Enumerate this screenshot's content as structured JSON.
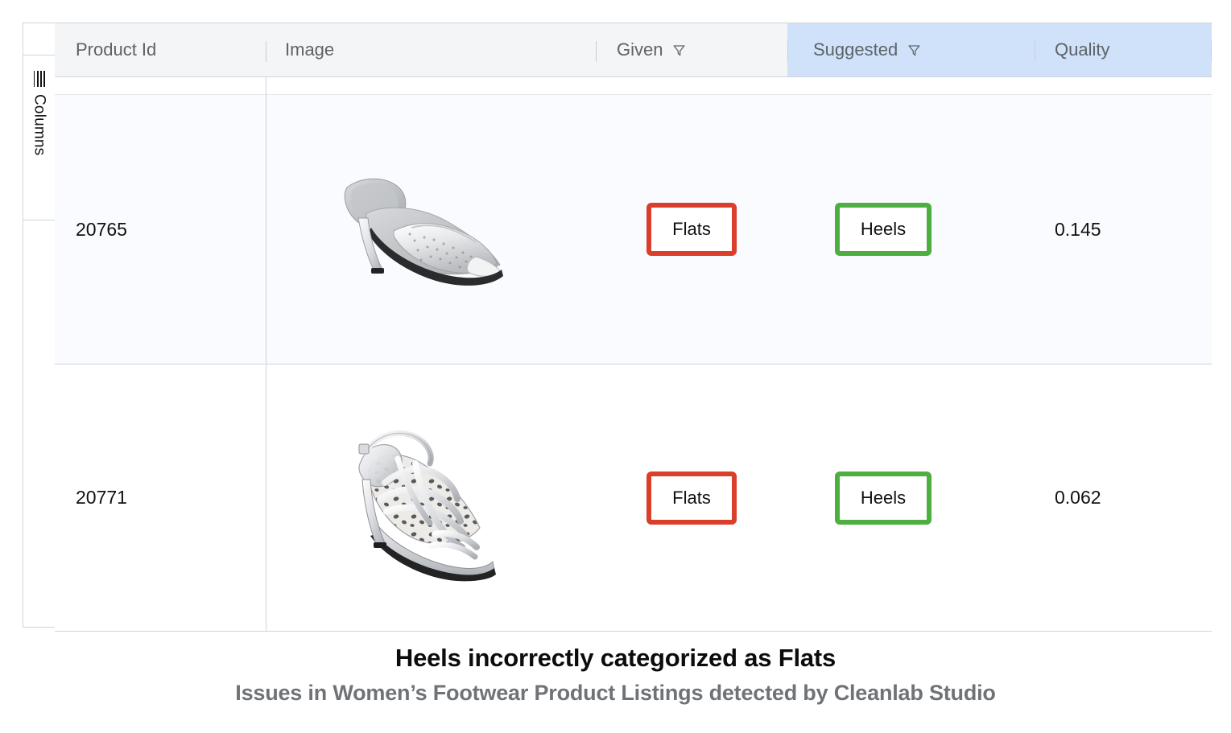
{
  "rail": {
    "label": "Columns",
    "icon": "columns-icon"
  },
  "table": {
    "headers": [
      {
        "key": "product_id",
        "label": "Product Id",
        "filter": false,
        "highlighted": false
      },
      {
        "key": "image",
        "label": "Image",
        "filter": false,
        "highlighted": false
      },
      {
        "key": "given",
        "label": "Given",
        "filter": true,
        "highlighted": false
      },
      {
        "key": "suggested",
        "label": "Suggested",
        "filter": true,
        "highlighted": true
      },
      {
        "key": "quality",
        "label": "Quality",
        "filter": false,
        "highlighted": true
      }
    ],
    "rows": [
      {
        "product_id": "20765",
        "image_alt": "silver-rhinestone-mule-heel",
        "given": "Flats",
        "suggested": "Heels",
        "quality": "0.145"
      },
      {
        "product_id": "20771",
        "image_alt": "silver-strappy-leopard-sandal-heel",
        "given": "Flats",
        "suggested": "Heels",
        "quality": "0.062"
      }
    ]
  },
  "caption": {
    "title": "Heels incorrectly categorized as Flats",
    "subtitle": "Issues in Women’s Footwear Product Listings detected by Cleanlab Studio"
  },
  "colors": {
    "given_border": "#d93f2b",
    "suggested_border": "#4caf3f",
    "header_highlight": "#cfe2f9",
    "header_bg": "#f4f5f6",
    "row_highlight": "#f9fbfe"
  }
}
